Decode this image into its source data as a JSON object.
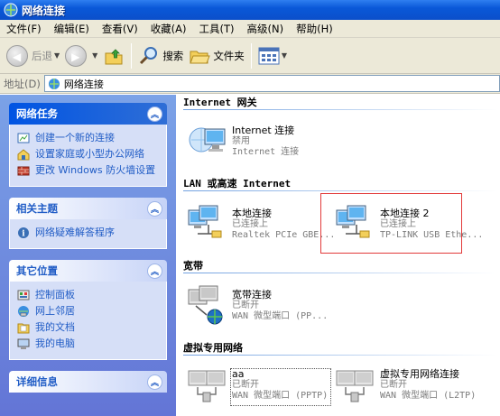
{
  "window": {
    "title": "网络连接"
  },
  "menu": [
    "文件(F)",
    "编辑(E)",
    "查看(V)",
    "收藏(A)",
    "工具(T)",
    "高级(N)",
    "帮助(H)"
  ],
  "toolbar": {
    "back": "后退",
    "search": "搜索",
    "folders": "文件夹"
  },
  "address": {
    "label": "地址(D)",
    "value": "网络连接"
  },
  "tasks": {
    "network_tasks": {
      "title": "网络任务",
      "items": [
        "创建一个新的连接",
        "设置家庭或小型办公网络",
        "更改 Windows 防火墙设置"
      ]
    },
    "related": {
      "title": "相关主题",
      "items": [
        "网络疑难解答程序"
      ]
    },
    "other": {
      "title": "其它位置",
      "items": [
        "控制面板",
        "网上邻居",
        "我的文档",
        "我的电脑"
      ]
    },
    "details": {
      "title": "详细信息"
    }
  },
  "sections": {
    "internet_gateway": {
      "title": "Internet 网关",
      "items": [
        {
          "name": "Internet 连接",
          "status": "禁用",
          "device": "Internet 连接"
        }
      ]
    },
    "lan": {
      "title": "LAN 或高速 Internet",
      "items": [
        {
          "name": "本地连接",
          "status": "已连接上",
          "device": "Realtek PCIe GBE..."
        },
        {
          "name": "本地连接 2",
          "status": "已连接上",
          "device": "TP-LINK USB Ethe..."
        }
      ]
    },
    "broadband": {
      "title": "宽带",
      "items": [
        {
          "name": "宽带连接",
          "status": "已断开",
          "device": "WAN 微型端口 (PP..."
        }
      ]
    },
    "vpn": {
      "title": "虚拟专用网络",
      "items": [
        {
          "name": "aa",
          "status": "已断开",
          "device": "WAN 微型端口 (PPTP)"
        },
        {
          "name": "虚拟专用网络连接",
          "status": "已断开",
          "device": "WAN 微型端口 (L2TP)"
        }
      ]
    }
  },
  "colors": {
    "titlebar": "#0a58d8",
    "taskpane": "#6375d6",
    "link": "#215dc6",
    "highlight": "#e23a3a"
  }
}
